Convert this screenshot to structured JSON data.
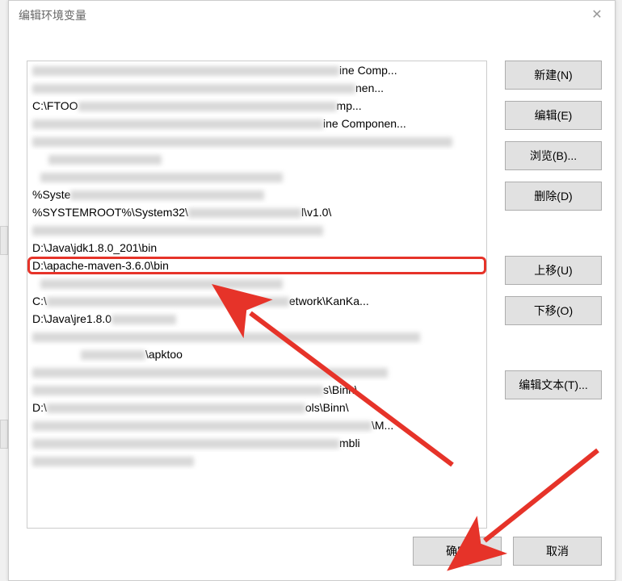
{
  "title": "编辑环境变量",
  "buttons": {
    "new": "新建(N)",
    "edit": "编辑(E)",
    "browse": "浏览(B)...",
    "delete": "删除(D)",
    "up": "上移(U)",
    "down": "下移(O)",
    "edit_text": "编辑文本(T)...",
    "ok": "确定",
    "cancel": "取消"
  },
  "list": [
    {
      "blurred": true,
      "blur_width": 380,
      "tail": "ine Comp..."
    },
    {
      "blurred": true,
      "blur_width": 400,
      "tail": "nen..."
    },
    {
      "text": "C:\\FTOO",
      "blurred_after": true,
      "blur_width": 320,
      "tail": "mp..."
    },
    {
      "blurred": true,
      "blur_width": 360,
      "tail": "ine Componen..."
    },
    {
      "blurred": true,
      "blur_width": 520
    },
    {
      "blurred": true,
      "blur_width": 140,
      "indent": 20
    },
    {
      "blurred": true,
      "blur_width": 300,
      "indent": 10
    },
    {
      "text": "%Syste",
      "blurred_after": true,
      "blur_width": 240
    },
    {
      "text": "%SYSTEMROOT%\\System32\\",
      "blurred_after": true,
      "blur_width": 140,
      "tail": "l\\v1.0\\"
    },
    {
      "blurred": true,
      "blur_width": 360
    },
    {
      "text": "D:\\Java\\jdk1.8.0_201\\bin"
    },
    {
      "text": "D:\\apache-maven-3.6.0\\bin",
      "highlight": true
    },
    {
      "blurred": true,
      "blur_width": 300,
      "indent": 10
    },
    {
      "text": "C:\\",
      "blurred_after": true,
      "blur_width": 300,
      "tail": "etwork\\KanKa..."
    },
    {
      "text": "D:\\Java\\jre1.8.0",
      "blurred_after": true,
      "blur_width": 80
    },
    {
      "blurred": true,
      "blur_width": 480
    },
    {
      "text": "",
      "blurred_after": true,
      "blur_width": 80,
      "tail": "\\apktoo",
      "indent": 60
    },
    {
      "blurred": true,
      "blur_width": 440
    },
    {
      "blurred": true,
      "blur_width": 360,
      "tail": "s\\Binn\\"
    },
    {
      "text": "D:\\",
      "blurred_after": true,
      "blur_width": 320,
      "tail": "ols\\Binn\\"
    },
    {
      "blurred": true,
      "blur_width": 420,
      "tail": "\\M..."
    },
    {
      "blurred": true,
      "blur_width": 380,
      "tail": "mbli"
    },
    {
      "blurred": true,
      "blur_width": 200
    }
  ]
}
